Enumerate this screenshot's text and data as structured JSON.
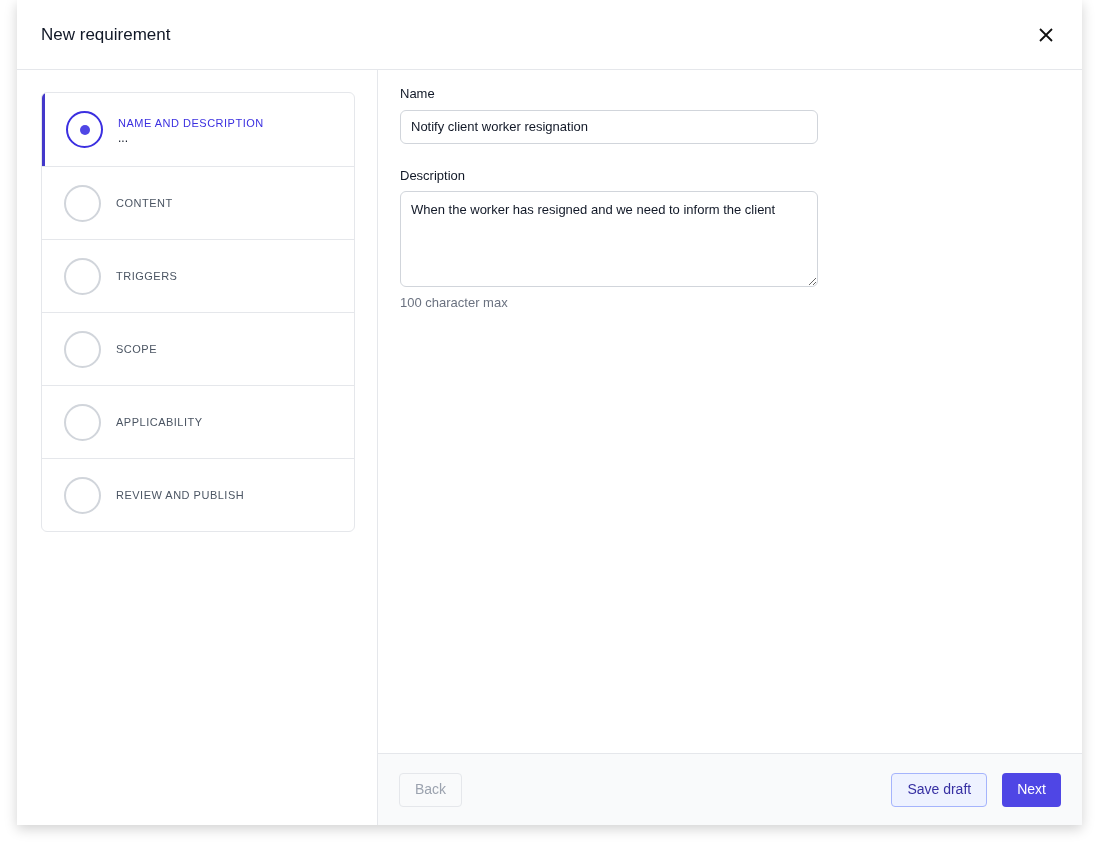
{
  "dialog": {
    "title": "New requirement"
  },
  "steps": [
    {
      "label": "NAME AND DESCRIPTION",
      "subtitle": "...",
      "selected": true
    },
    {
      "label": "CONTENT",
      "selected": false
    },
    {
      "label": "TRIGGERS",
      "selected": false
    },
    {
      "label": "SCOPE",
      "selected": false
    },
    {
      "label": "APPLICABILITY",
      "selected": false
    },
    {
      "label": "REVIEW AND PUBLISH",
      "selected": false
    }
  ],
  "form": {
    "name": {
      "label": "Name",
      "value": "Notify client worker resignation"
    },
    "description": {
      "label": "Description",
      "value": "When the worker has resigned and we need to inform the client",
      "hint": "100 character max"
    }
  },
  "footer": {
    "back": {
      "label": "Back",
      "disabled": true
    },
    "save_draft": {
      "label": "Save draft"
    },
    "next": {
      "label": "Next"
    }
  }
}
